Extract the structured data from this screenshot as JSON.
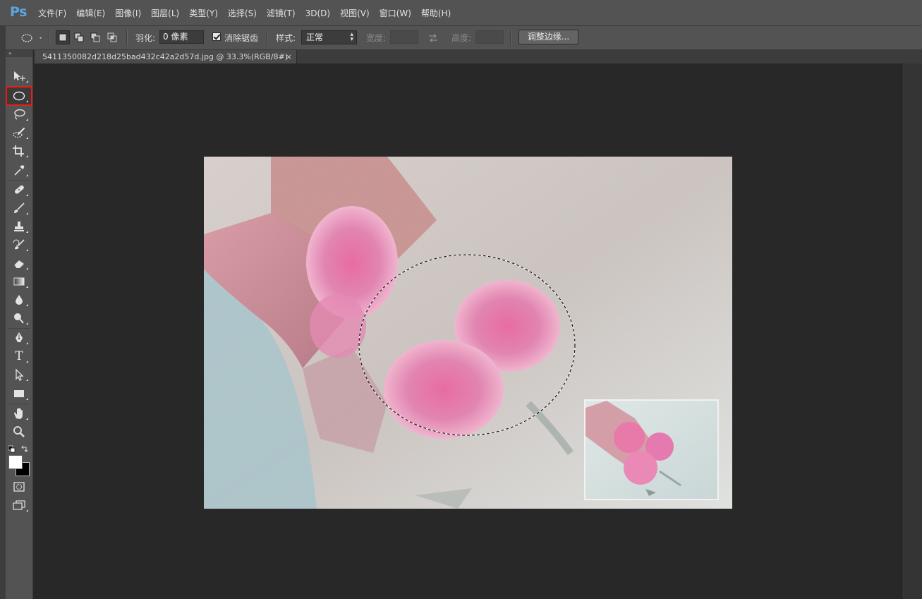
{
  "app": {
    "logo": "Ps"
  },
  "menubar": {
    "items": [
      "文件(F)",
      "编辑(E)",
      "图像(I)",
      "图层(L)",
      "类型(Y)",
      "选择(S)",
      "滤镜(T)",
      "3D(D)",
      "视图(V)",
      "窗口(W)",
      "帮助(H)"
    ]
  },
  "options": {
    "feather_label": "羽化:",
    "feather_value": "0 像素",
    "antialias_label": "消除锯齿",
    "antialias_checked": true,
    "style_label": "样式:",
    "style_value": "正常",
    "width_label": "宽度:",
    "height_label": "高度:",
    "refine_edge_label": "调整边缘..."
  },
  "document": {
    "tab_title": "5411350082d218d25bad432c42a2d57d.jpg @ 33.3%(RGB/8#)",
    "close_glyph": "×"
  },
  "tools": [
    {
      "name": "move-tool",
      "icon": "move-icon"
    },
    {
      "name": "elliptical-marquee-tool",
      "icon": "ellipse-marquee-icon",
      "active": true
    },
    {
      "name": "lasso-tool",
      "icon": "lasso-icon"
    },
    {
      "name": "quick-selection-tool",
      "icon": "quick-selection-icon"
    },
    {
      "name": "crop-tool",
      "icon": "crop-icon"
    },
    {
      "name": "eyedropper-tool",
      "icon": "eyedropper-icon"
    },
    {
      "name": "healing-brush-tool",
      "icon": "bandage-icon"
    },
    {
      "name": "brush-tool",
      "icon": "brush-icon"
    },
    {
      "name": "clone-stamp-tool",
      "icon": "stamp-icon"
    },
    {
      "name": "history-brush-tool",
      "icon": "history-brush-icon"
    },
    {
      "name": "eraser-tool",
      "icon": "eraser-icon"
    },
    {
      "name": "gradient-tool",
      "icon": "gradient-icon"
    },
    {
      "name": "blur-tool",
      "icon": "drop-icon"
    },
    {
      "name": "dodge-tool",
      "icon": "dodge-icon"
    },
    {
      "name": "pen-tool",
      "icon": "pen-icon"
    },
    {
      "name": "type-tool",
      "icon": "type-icon",
      "glyph": "T"
    },
    {
      "name": "path-selection-tool",
      "icon": "arrow-icon"
    },
    {
      "name": "rectangle-tool",
      "icon": "rectangle-icon"
    },
    {
      "name": "hand-tool",
      "icon": "hand-icon"
    },
    {
      "name": "zoom-tool",
      "icon": "magnifier-icon"
    }
  ],
  "colors": {
    "foreground": "#ffffff",
    "background": "#000000",
    "active_tool_outline": "#e0221a",
    "ps_logo": "#5aa6e0"
  }
}
